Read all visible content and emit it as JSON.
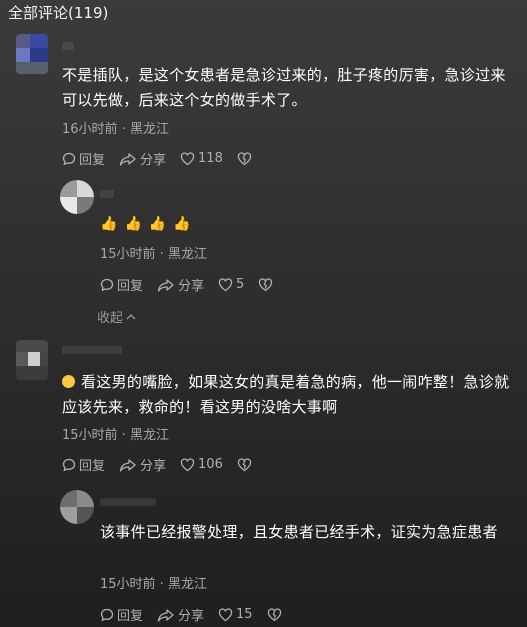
{
  "header": {
    "title": "全部评论(119)"
  },
  "comments": [
    {
      "text": "不是插队，是这个女患者是急诊过来的，肚子疼的厉害，急诊过来可以先做，后来这个女的做手术了。",
      "meta": "16小时前 · 黑龙江",
      "reply_label": "回复",
      "share_label": "分享",
      "likes": "118"
    },
    {
      "emojis": [
        "👍",
        "👍",
        "👍",
        "👍"
      ],
      "meta": "15小时前 · 黑龙江",
      "reply_label": "回复",
      "share_label": "分享",
      "likes": "5",
      "collapse_label": "收起"
    },
    {
      "text": "看这男的嘴脸，如果这女的真是着急的病，他一闹咋整！急诊就应该先来，救命的！看这男的没啥大事啊",
      "meta": "15小时前 · 黑龙江",
      "reply_label": "回复",
      "share_label": "分享",
      "likes": "106"
    },
    {
      "text": "该事件已经报警处理，且女患者已经手术，证实为急症患者",
      "meta": "15小时前 · 黑龙江",
      "reply_label": "回复",
      "share_label": "分享",
      "likes": "15"
    }
  ],
  "colors": {
    "accent_like": "#b0b0b0",
    "emoji_yellow": "#f6c945"
  },
  "icons": [
    "comment-bubble-icon",
    "share-arrow-icon",
    "heart-icon",
    "dislike-heart-icon",
    "chevron-up-icon",
    "angry-face-emoji"
  ]
}
